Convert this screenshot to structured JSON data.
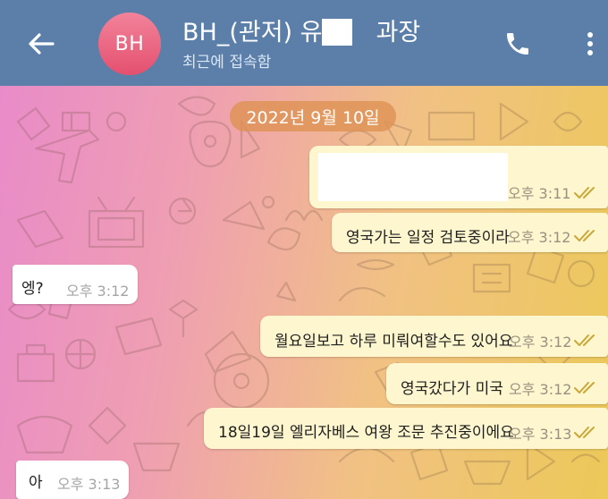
{
  "header": {
    "avatar_initials": "BH",
    "title": "BH_(관저) 유       과장",
    "status": "최근에 접속함",
    "accent_color": "#5b7fa8",
    "back_icon": "arrow-left-icon",
    "call_icon": "phone-icon",
    "menu_icon": "more-vertical-icon"
  },
  "chat": {
    "date": "2022년 9월 10일",
    "messages": [
      {
        "direction": "out",
        "text": "",
        "time": "오후 3:11",
        "read": true,
        "redacted": true
      },
      {
        "direction": "out",
        "text": "영국가는 일정 검토중이라",
        "time": "오후 3:12",
        "read": true
      },
      {
        "direction": "in",
        "text": "엥?",
        "time": "오후 3:12"
      },
      {
        "direction": "out",
        "text": "월요일보고 하루 미뤄여할수도 있어요",
        "time": "오후 3:12",
        "read": true
      },
      {
        "direction": "out",
        "text": "영국갔다가 미국",
        "time": "오후 3:12",
        "read": true
      },
      {
        "direction": "out",
        "text": "18일19일 엘리자베스 여왕 조문 추진중이에요",
        "time": "오후 3:13",
        "read": true
      },
      {
        "direction": "in",
        "text": "아",
        "time": "오후 3:13"
      }
    ]
  },
  "colors": {
    "outgoing_bubble": "#fdf6cf",
    "incoming_bubble": "#ffffff",
    "read_ticks": "#c9a83a",
    "date_pill": "#de9254"
  }
}
